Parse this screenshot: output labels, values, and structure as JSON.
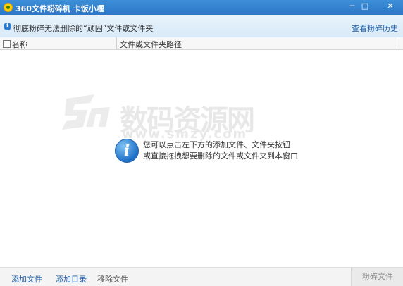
{
  "window": {
    "title": "360文件粉碎机 卡饭小喱",
    "minimize_glyph": "─",
    "maximize_glyph": "□",
    "close_glyph": "✕"
  },
  "infobar": {
    "icon": "i",
    "text": "彻底粉碎无法删除的“顽固”文件或文件夹",
    "history_link": "查看粉碎历史"
  },
  "table": {
    "columns": [
      "名称",
      "文件或文件夹路径"
    ]
  },
  "empty_state": {
    "icon": "i",
    "line1": "您可以点击左下方的添加文件、文件夹按钮",
    "line2": "或直接拖拽想要删除的文件或文件夹到本窗口"
  },
  "watermark": {
    "text": "数码资源网",
    "url": "www.smzy.com"
  },
  "footer": {
    "add_file": "添加文件",
    "add_dir": "添加目录",
    "remove_file": "移除文件",
    "shred": "粉碎文件"
  }
}
